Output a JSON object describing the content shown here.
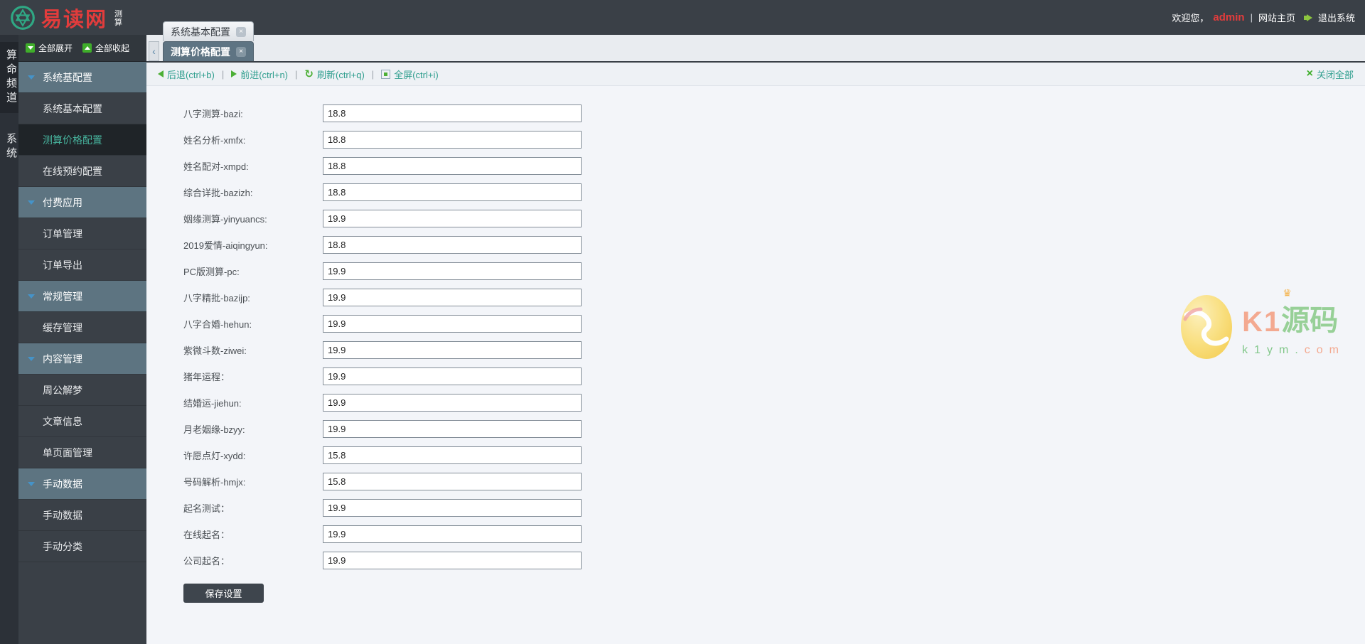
{
  "topbar": {
    "logo_text": "易读网",
    "logo_sub_1": "测",
    "logo_sub_2": "算",
    "welcome_prefix": "欢迎您，",
    "username": "admin",
    "separator": "|",
    "home_link": "网站主页",
    "logout": "退出系统"
  },
  "vertical_nav": {
    "items": [
      {
        "label": "算命频道",
        "active": true
      },
      {
        "label": "系统",
        "active": false
      }
    ]
  },
  "sidebar": {
    "expand_all": "全部展开",
    "collapse_all": "全部收起",
    "items": [
      {
        "label": "系统基配置",
        "type": "group"
      },
      {
        "label": "系统基本配置",
        "type": "item"
      },
      {
        "label": "测算价格配置",
        "type": "item",
        "selected": true
      },
      {
        "label": "在线预约配置",
        "type": "item"
      },
      {
        "label": "付费应用",
        "type": "group"
      },
      {
        "label": "订单管理",
        "type": "item"
      },
      {
        "label": "订单导出",
        "type": "item"
      },
      {
        "label": "常规管理",
        "type": "group"
      },
      {
        "label": "缓存管理",
        "type": "item"
      },
      {
        "label": "内容管理",
        "type": "group"
      },
      {
        "label": "周公解梦",
        "type": "item"
      },
      {
        "label": "文章信息",
        "type": "item"
      },
      {
        "label": "单页面管理",
        "type": "item"
      },
      {
        "label": "手动数据",
        "type": "group"
      },
      {
        "label": "手动数据",
        "type": "item"
      },
      {
        "label": "手动分类",
        "type": "item"
      }
    ]
  },
  "tabs": [
    {
      "label": "系统基本配置",
      "active": false
    },
    {
      "label": "测算价格配置",
      "active": true
    }
  ],
  "toolbar": {
    "back": "后退(ctrl+b)",
    "forward": "前进(ctrl+n)",
    "refresh": "刷新(ctrl+q)",
    "fullscreen": "全屏(ctrl+i)",
    "close_all": "关闭全部",
    "separator": "|",
    "scroll_left_glyph": "‹",
    "refresh_glyph": "↻",
    "close_glyph": "×"
  },
  "form": {
    "fields": [
      {
        "label": "八字测算-bazi:",
        "value": "18.8"
      },
      {
        "label": "姓名分析-xmfx:",
        "value": "18.8"
      },
      {
        "label": "姓名配对-xmpd:",
        "value": "18.8"
      },
      {
        "label": "综合详批-bazizh:",
        "value": "18.8"
      },
      {
        "label": "姻缘测算-yinyuancs:",
        "value": "19.9"
      },
      {
        "label": "2019爱情-aiqingyun:",
        "value": "18.8"
      },
      {
        "label": "PC版测算-pc:",
        "value": "19.9"
      },
      {
        "label": "八字精批-bazijp:",
        "value": "19.9"
      },
      {
        "label": "八字合婚-hehun:",
        "value": "19.9"
      },
      {
        "label": "紫微斗数-ziwei:",
        "value": "19.9"
      },
      {
        "label": "猪年运程：",
        "value": "19.9"
      },
      {
        "label": "结婚运-jiehun:",
        "value": "19.9"
      },
      {
        "label": "月老姻缘-bzyy:",
        "value": "19.9"
      },
      {
        "label": "许愿点灯-xydd:",
        "value": "15.8"
      },
      {
        "label": "号码解析-hmjx:",
        "value": "15.8"
      },
      {
        "label": "起名测试：",
        "value": "19.9"
      },
      {
        "label": "在线起名：",
        "value": "19.9"
      },
      {
        "label": "公司起名：",
        "value": "19.9"
      }
    ],
    "save_label": "保存设置"
  },
  "watermark": {
    "brand_latin": "K1",
    "brand_cn": "源码",
    "crown_glyph": "♛",
    "domain_green": "k1ym.",
    "domain_orange": "com"
  },
  "colors": {
    "topbar_bg": "#3a4047",
    "brand_red": "#e23c3c",
    "accent_green": "#3fae2a",
    "link_teal": "#2f9e8e",
    "group_bg": "#5d7481",
    "selected_text": "#47b49e",
    "tab_active_bg": "#5e7483"
  }
}
